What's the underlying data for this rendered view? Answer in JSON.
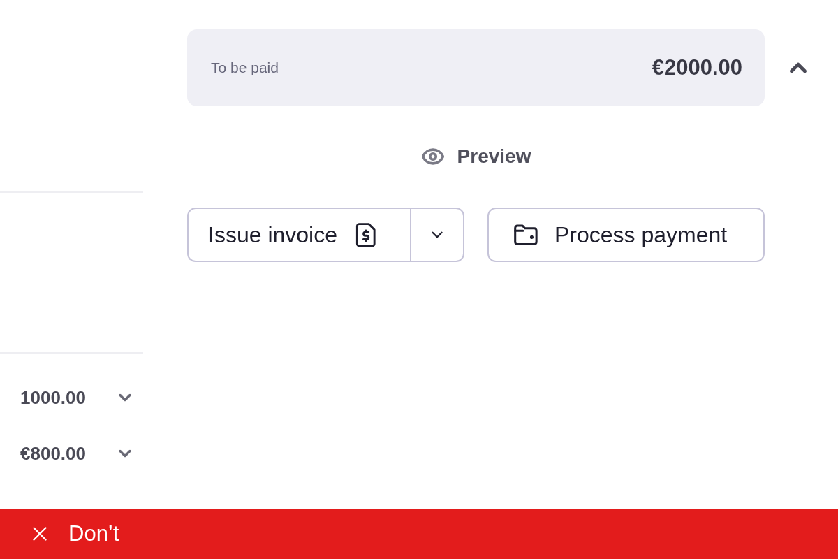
{
  "side_list": [
    {
      "amount": "1000.00",
      "expanded": false
    },
    {
      "amount": "€800.00",
      "expanded": false
    }
  ],
  "summary": {
    "label": "To be paid",
    "amount": "€2000.00",
    "expanded": true
  },
  "preview": {
    "label": "Preview"
  },
  "actions": [
    {
      "kind": "split",
      "label": "Issue invoice"
    },
    {
      "kind": "plain",
      "label": "Process payment"
    }
  ],
  "banner": {
    "kind": "dont",
    "label": "Don’t"
  }
}
